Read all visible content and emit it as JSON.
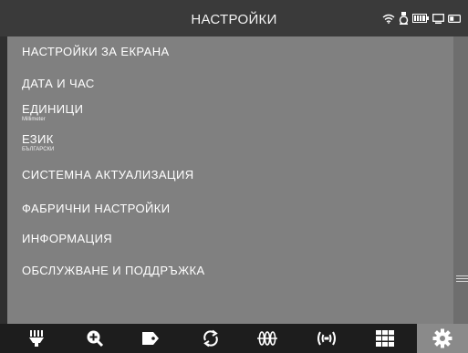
{
  "header": {
    "title": "НАСТРОЙКИ",
    "status_icons": [
      "wifi-icon",
      "probe-icon",
      "battery-icon",
      "monitor-icon",
      "toggle-icon"
    ]
  },
  "menu": {
    "items": [
      {
        "label": "НАСТРОЙКИ ЗА ЕКРАНА",
        "sub": ""
      },
      {
        "label": "ДАТА И ЧАС",
        "sub": ""
      },
      {
        "label": "ЕДИНИЦИ",
        "sub": "Millimeter"
      },
      {
        "label": "ЕЗИК",
        "sub": "БЪЛГАРСКИ"
      },
      {
        "label": "СИСТЕМНА АКТУАЛИЗАЦИЯ",
        "sub": ""
      },
      {
        "label": "ФАБРИЧНИ НАСТРОЙКИ",
        "sub": ""
      },
      {
        "label": "ИНФОРМАЦИЯ",
        "sub": ""
      },
      {
        "label": "ОБСЛУЖВАНЕ И ПОДДРЪЖКА",
        "sub": ""
      }
    ]
  },
  "toolbar": {
    "tabs": [
      {
        "icon": "probe-tab-icon",
        "active": false
      },
      {
        "icon": "zoom-in-icon",
        "active": false
      },
      {
        "icon": "tag-icon",
        "active": false
      },
      {
        "icon": "rotate-icon",
        "active": false
      },
      {
        "icon": "coil-icon",
        "active": false
      },
      {
        "icon": "signal-icon",
        "active": false
      },
      {
        "icon": "grid-icon",
        "active": false
      },
      {
        "icon": "gear-icon",
        "active": true
      }
    ]
  },
  "colors": {
    "background": "#2f2f2f",
    "content": "#808080",
    "header": "#3a3a3a",
    "toolbar": "#1d1d1d",
    "active_tab": "#8a8a8a"
  }
}
